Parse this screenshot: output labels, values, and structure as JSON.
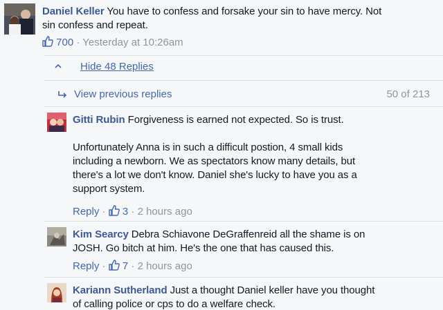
{
  "top_comment": {
    "author": "Daniel Keller",
    "text_line1": "You have to confess and forsake your sin to have mercy. Not",
    "text_line2": "sin confess and repeat.",
    "likes": "700",
    "separator": "·",
    "timestamp": "Yesterday at 10:26am"
  },
  "hide_replies": {
    "label": "Hide 48 Replies"
  },
  "view_previous": {
    "label": "View previous replies",
    "count": "50 of 213"
  },
  "replies": [
    {
      "author": "Gitti Rubin",
      "text_line1": "Forgiveness is earned not expected. So is trust.",
      "para2_line1": "Unfortunately Anna is in such a difficult postion, 4 small kids",
      "para2_line2": "including a newborn. We as spectators know many details, but",
      "para2_line3": "there's a lot we don't know. Daniel she's lucky to have you as a",
      "para2_line4": "support system.",
      "reply_label": "Reply",
      "separator": "·",
      "likes": "3",
      "separator2": "·",
      "timestamp": "2 hours ago"
    },
    {
      "author": "Kim Searcy",
      "text_line1": "Debra Schiavone DeGraffenreid all the shame is on",
      "text_line2": "JOSH. Go bitch at him. He's the one that has caused this.",
      "reply_label": "Reply",
      "separator": "·",
      "likes": "7",
      "separator2": "·",
      "timestamp": "2 hours ago"
    },
    {
      "author": "Kariann Sutherland",
      "text_line1": "Just a thought Daniel keller have you thought",
      "text_line2": "of calling police or cps to do a welfare check."
    }
  ],
  "colors": {
    "link": "#4267b2",
    "name": "#3b5998",
    "meta": "#90949c"
  }
}
